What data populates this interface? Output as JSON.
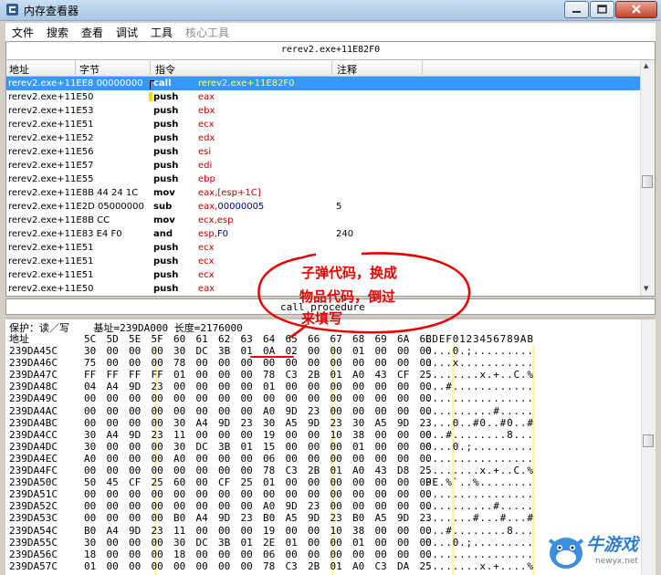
{
  "window": {
    "title": "内存查看器",
    "icon": "cheat-engine-icon"
  },
  "menu": {
    "items": [
      "文件",
      "搜索",
      "查看",
      "调试",
      "工具",
      "核心工具"
    ]
  },
  "disasm": {
    "address": "rerev2.exe+11E82F0",
    "headers": {
      "addr": "地址",
      "bytes": "字节",
      "instr": "指令",
      "comment": "注释"
    },
    "rows": [
      {
        "addr": "rerev2.exe+11EE8 00000000",
        "op": "call",
        "arg": "rerev2.exe+11E82F0",
        "comment": ""
      },
      {
        "addr": "rerev2.exe+11E50",
        "op": "push",
        "arg": "eax",
        "comment": ""
      },
      {
        "addr": "rerev2.exe+11E53",
        "op": "push",
        "arg": "ebx",
        "comment": ""
      },
      {
        "addr": "rerev2.exe+11E51",
        "op": "push",
        "arg": "ecx",
        "comment": ""
      },
      {
        "addr": "rerev2.exe+11E52",
        "op": "push",
        "arg": "edx",
        "comment": ""
      },
      {
        "addr": "rerev2.exe+11E56",
        "op": "push",
        "arg": "esi",
        "comment": ""
      },
      {
        "addr": "rerev2.exe+11E57",
        "op": "push",
        "arg": "edi",
        "comment": ""
      },
      {
        "addr": "rerev2.exe+11E55",
        "op": "push",
        "arg": "ebp",
        "comment": ""
      },
      {
        "addr": "rerev2.exe+11E8B 44 24 1C",
        "op": "mov",
        "arg": "eax,[esp+1C]",
        "comment": ""
      },
      {
        "addr": "rerev2.exe+11E2D 05000000",
        "op": "sub",
        "arg": "eax,00000005",
        "comment": "5"
      },
      {
        "addr": "rerev2.exe+11E8B CC",
        "op": "mov",
        "arg": "ecx,esp",
        "comment": ""
      },
      {
        "addr": "rerev2.exe+11E83 E4 F0",
        "op": "and",
        "arg": "esp,F0",
        "comment": "240"
      },
      {
        "addr": "rerev2.exe+11E51",
        "op": "push",
        "arg": "ecx",
        "comment": ""
      },
      {
        "addr": "rerev2.exe+11E51",
        "op": "push",
        "arg": "ecx",
        "comment": ""
      },
      {
        "addr": "rerev2.exe+11E51",
        "op": "push",
        "arg": "ecx",
        "comment": ""
      },
      {
        "addr": "rerev2.exe+11E50",
        "op": "push",
        "arg": "eax",
        "comment": ""
      }
    ]
  },
  "status": {
    "text": "call procedure"
  },
  "hex": {
    "protection": "保护：读／写    基址=239DA000 长度=2176000",
    "header_addr": "地址",
    "header_cols": [
      "5C",
      "5D",
      "5E",
      "5F",
      "60",
      "61",
      "62",
      "63",
      "64",
      "65",
      "66",
      "67",
      "68",
      "69",
      "6A",
      "6B"
    ],
    "header_ascii": "CDEF0123456789AB",
    "rows": [
      {
        "addr": "239DA45C",
        "bytes": [
          "30",
          "00",
          "00",
          "00",
          "30",
          "DC",
          "3B",
          "01",
          "0A",
          "02",
          "00",
          "00",
          "01",
          "00",
          "00",
          "00"
        ],
        "ascii": "0...0.;........."
      },
      {
        "addr": "239DA46C",
        "bytes": [
          "75",
          "00",
          "00",
          "00",
          "78",
          "00",
          "00",
          "00",
          "00",
          "00",
          "00",
          "00",
          "00",
          "00",
          "00",
          "00"
        ],
        "ascii": "u...x..........."
      },
      {
        "addr": "239DA47C",
        "bytes": [
          "FF",
          "FF",
          "FF",
          "FF",
          "01",
          "00",
          "00",
          "00",
          "78",
          "C3",
          "2B",
          "01",
          "A0",
          "43",
          "CF",
          "25"
        ],
        "ascii": "........x.+..C.%"
      },
      {
        "addr": "239DA48C",
        "bytes": [
          "04",
          "A4",
          "9D",
          "23",
          "00",
          "00",
          "00",
          "00",
          "01",
          "00",
          "00",
          "00",
          "00",
          "00",
          "00",
          "00"
        ],
        "ascii": "...#............"
      },
      {
        "addr": "239DA49C",
        "bytes": [
          "00",
          "00",
          "00",
          "00",
          "00",
          "00",
          "00",
          "00",
          "00",
          "00",
          "00",
          "00",
          "00",
          "00",
          "00",
          "00"
        ],
        "ascii": "................"
      },
      {
        "addr": "239DA4AC",
        "bytes": [
          "00",
          "00",
          "00",
          "00",
          "00",
          "00",
          "00",
          "00",
          "A0",
          "9D",
          "23",
          "00",
          "00",
          "00",
          "00",
          "00"
        ],
        "ascii": "..........#....."
      },
      {
        "addr": "239DA4BC",
        "bytes": [
          "00",
          "00",
          "00",
          "00",
          "30",
          "A4",
          "9D",
          "23",
          "30",
          "A5",
          "9D",
          "23",
          "30",
          "A5",
          "9D",
          "23"
        ],
        "ascii": "....0..#0..#0..#"
      },
      {
        "addr": "239DA4CC",
        "bytes": [
          "30",
          "A4",
          "9D",
          "23",
          "11",
          "00",
          "00",
          "00",
          "19",
          "00",
          "00",
          "10",
          "38",
          "00",
          "00",
          "00"
        ],
        "ascii": "0..#........8..."
      },
      {
        "addr": "239DA4DC",
        "bytes": [
          "30",
          "00",
          "00",
          "00",
          "30",
          "DC",
          "3B",
          "01",
          "15",
          "00",
          "00",
          "00",
          "01",
          "00",
          "00",
          "00"
        ],
        "ascii": "0...0.;........."
      },
      {
        "addr": "239DA4EC",
        "bytes": [
          "A0",
          "00",
          "00",
          "00",
          "A0",
          "00",
          "00",
          "00",
          "06",
          "00",
          "00",
          "00",
          "00",
          "00",
          "00",
          "00"
        ],
        "ascii": "................"
      },
      {
        "addr": "239DA4FC",
        "bytes": [
          "00",
          "00",
          "00",
          "00",
          "00",
          "00",
          "00",
          "00",
          "78",
          "C3",
          "2B",
          "01",
          "A0",
          "43",
          "D8",
          "25"
        ],
        "ascii": "........x.+..C.%"
      },
      {
        "addr": "239DA50C",
        "bytes": [
          "50",
          "45",
          "CF",
          "25",
          "60",
          "00",
          "CF",
          "25",
          "01",
          "00",
          "00",
          "00",
          "00",
          "00",
          "00",
          "00"
        ],
        "ascii": "PE.%`..%........"
      },
      {
        "addr": "239DA51C",
        "bytes": [
          "00",
          "00",
          "00",
          "00",
          "00",
          "00",
          "00",
          "00",
          "00",
          "00",
          "00",
          "00",
          "00",
          "00",
          "00",
          "00"
        ],
        "ascii": "................"
      },
      {
        "addr": "239DA52C",
        "bytes": [
          "00",
          "00",
          "00",
          "00",
          "00",
          "00",
          "00",
          "00",
          "A0",
          "9D",
          "23",
          "00",
          "00",
          "00",
          "00",
          "00"
        ],
        "ascii": "..........#....."
      },
      {
        "addr": "239DA53C",
        "bytes": [
          "00",
          "00",
          "00",
          "00",
          "B0",
          "A4",
          "9D",
          "23",
          "B0",
          "A5",
          "9D",
          "23",
          "B0",
          "A5",
          "9D",
          "23"
        ],
        "ascii": ".......#...#...#"
      },
      {
        "addr": "239DA54C",
        "bytes": [
          "B0",
          "A4",
          "9D",
          "23",
          "11",
          "00",
          "00",
          "00",
          "19",
          "00",
          "00",
          "10",
          "38",
          "00",
          "00",
          "00"
        ],
        "ascii": "...#........8..."
      },
      {
        "addr": "239DA55C",
        "bytes": [
          "30",
          "00",
          "00",
          "00",
          "30",
          "DC",
          "3B",
          "01",
          "2E",
          "01",
          "00",
          "00",
          "01",
          "00",
          "00",
          "00"
        ],
        "ascii": "0...0.;........."
      },
      {
        "addr": "239DA56C",
        "bytes": [
          "18",
          "00",
          "00",
          "00",
          "18",
          "00",
          "00",
          "00",
          "06",
          "00",
          "00",
          "00",
          "00",
          "00",
          "00",
          "00"
        ],
        "ascii": "................"
      },
      {
        "addr": "239DA57C",
        "bytes": [
          "01",
          "00",
          "00",
          "00",
          "00",
          "00",
          "00",
          "00",
          "78",
          "C3",
          "2B",
          "01",
          "A0",
          "C3",
          "DA",
          "25"
        ],
        "ascii": "........x.+....%"
      }
    ]
  },
  "annotation": {
    "lines": [
      "子弹代码，换成",
      "物品代码，倒过",
      "来填写"
    ],
    "color": "#e60000"
  },
  "watermark": {
    "text": "牛游戏",
    "url": "newyx.net",
    "color": "#2f7fd0"
  }
}
